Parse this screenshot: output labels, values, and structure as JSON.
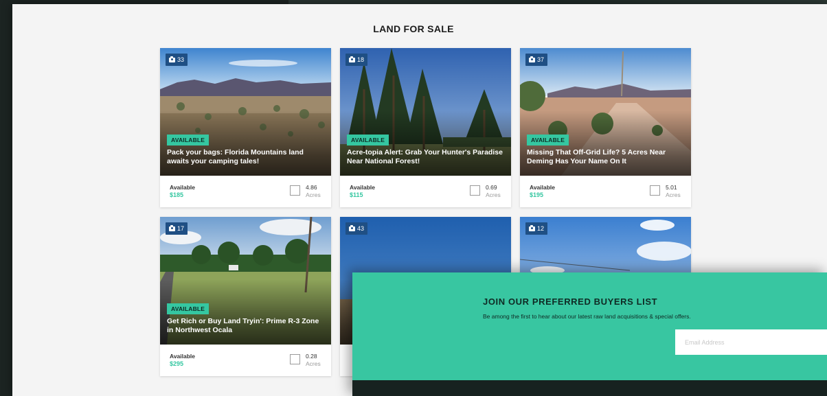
{
  "section": {
    "title": "LAND FOR SALE"
  },
  "listings": [
    {
      "photos": "33",
      "status": "AVAILABLE",
      "title": "Pack your bags: Florida Mountains land awaits your camping tales!",
      "availability": "Available",
      "price": "$185",
      "acres": "4.86",
      "acres_unit": "Acres"
    },
    {
      "photos": "18",
      "status": "AVAILABLE",
      "title": "Acre-topia Alert: Grab Your Hunter's Paradise Near National Forest!",
      "availability": "Available",
      "price": "$115",
      "acres": "0.69",
      "acres_unit": "Acres"
    },
    {
      "photos": "37",
      "status": "AVAILABLE",
      "title": "Missing That Off-Grid Life? 5 Acres Near Deming Has Your Name On It",
      "availability": "Available",
      "price": "$195",
      "acres": "5.01",
      "acres_unit": "Acres"
    },
    {
      "photos": "17",
      "status": "AVAILABLE",
      "title": "Get Rich or Buy Land Tryin': Prime R-3 Zone in Northwest Ocala",
      "availability": "Available",
      "price": "$295",
      "acres": "0.28",
      "acres_unit": "Acres"
    },
    {
      "photos": "43"
    },
    {
      "photos": "12"
    }
  ],
  "signup": {
    "title": "JOIN OUR PREFERRED BUYERS LIST",
    "subtitle": "Be among the first to hear about our latest raw land acquisitions & special offers.",
    "email_placeholder": "Email Address"
  },
  "colors": {
    "accent": "#35c7a1",
    "badge": "#1f4f84",
    "signup_bg": "#38c6a1"
  }
}
